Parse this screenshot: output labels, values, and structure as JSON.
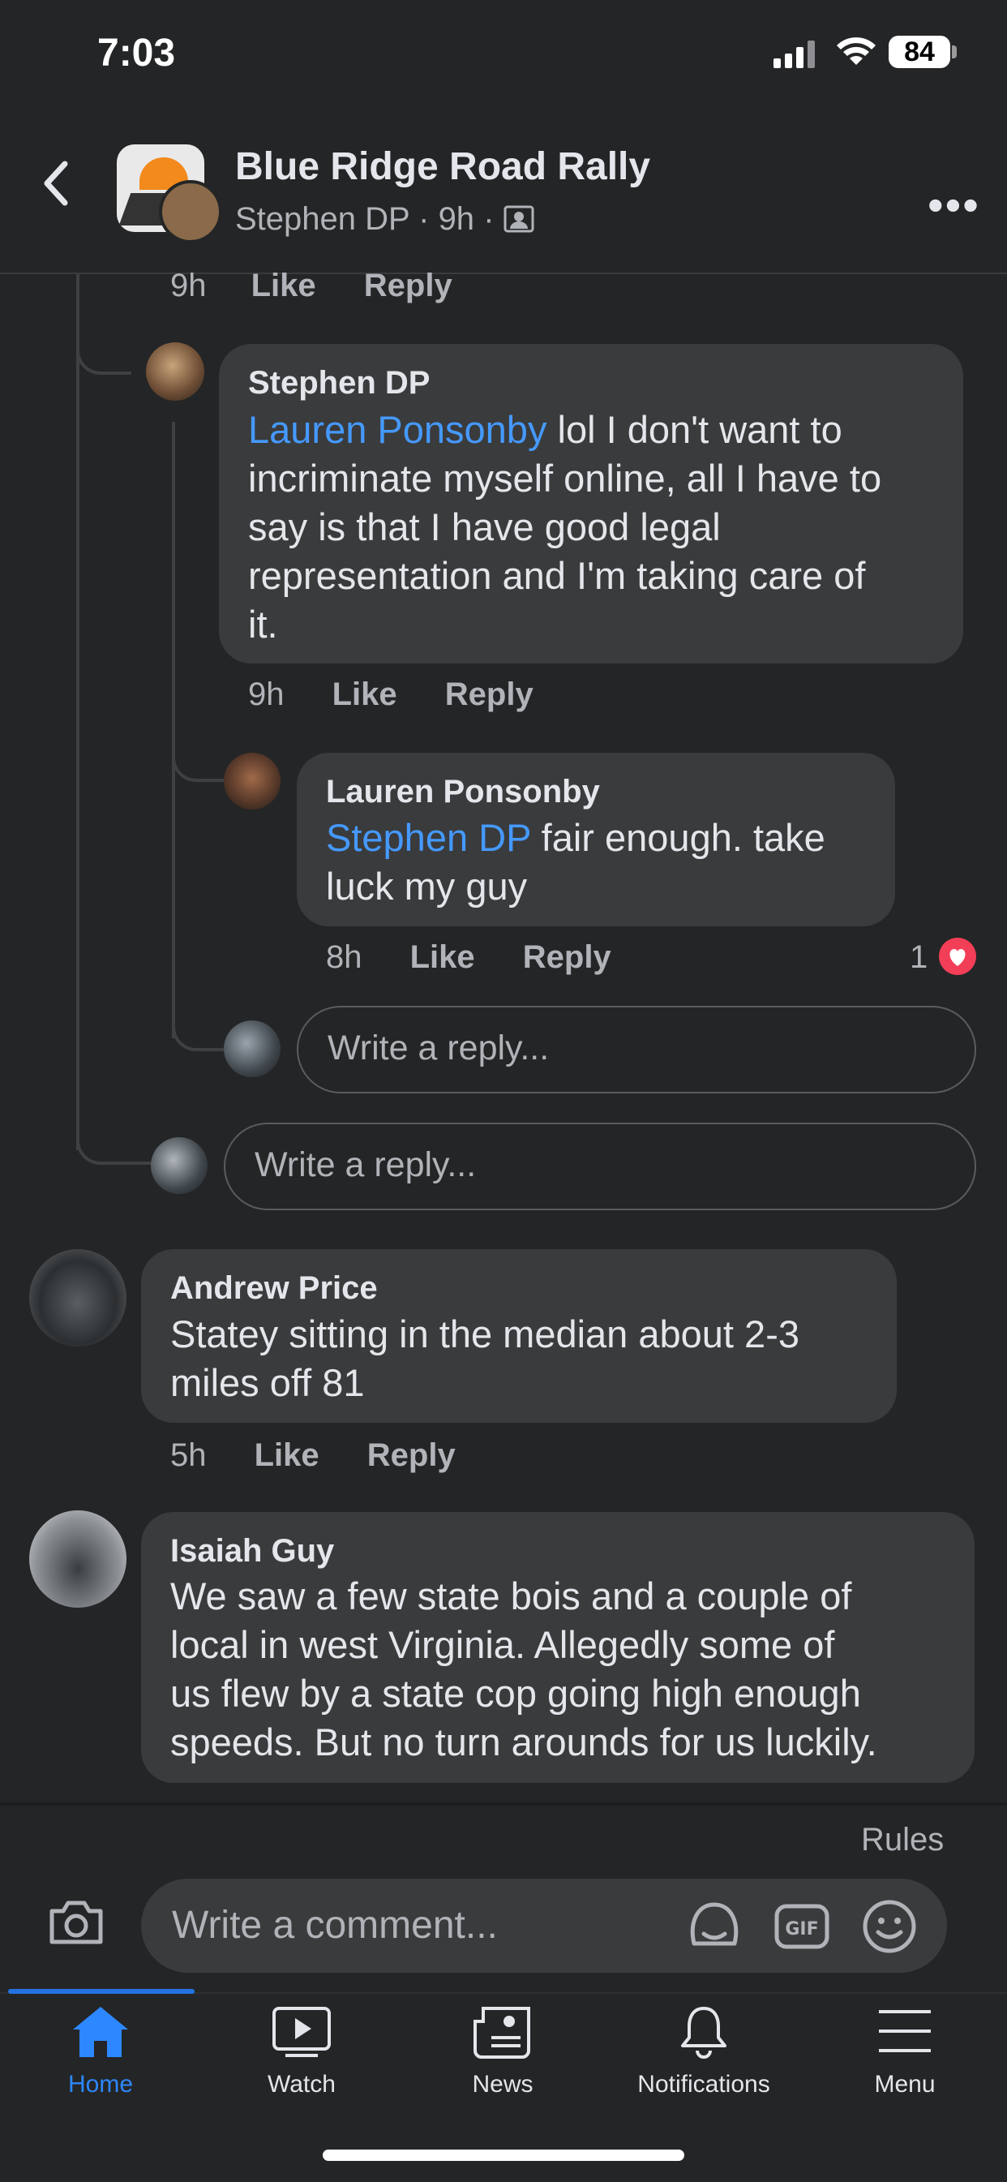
{
  "status": {
    "time": "7:03",
    "battery": "84"
  },
  "header": {
    "title": "Blue Ridge Road Rally",
    "subtitle_author": "Stephen DP",
    "subtitle_time": "9h",
    "sep": "·"
  },
  "top_meta": {
    "time": "9h",
    "like": "Like",
    "reply": "Reply"
  },
  "comments": [
    {
      "name": "Stephen DP",
      "mention": "Lauren Ponsonby",
      "text_lines": [
        " lol I don't want to",
        "incriminate myself online, all I have to",
        "say is that I have good legal",
        "representation and I'm taking care of",
        "it."
      ],
      "time": "9h",
      "like": "Like",
      "reply": "Reply"
    },
    {
      "name": "Lauren Ponsonby",
      "mention": "Stephen DP",
      "text_lines": [
        " fair enough. take",
        "luck my guy"
      ],
      "time": "8h",
      "like": "Like",
      "reply": "Reply",
      "reactions": "1"
    },
    {
      "name": "Andrew Price",
      "text_lines": [
        "Statey sitting in the median about 2-3",
        "miles off 81"
      ],
      "time": "5h",
      "like": "Like",
      "reply": "Reply"
    },
    {
      "name": "Isaiah Guy",
      "text_lines": [
        "We saw a few state bois and a couple of",
        "local in west Virginia. Allegedly some of",
        "us flew by a state cop going high enough",
        "speeds. But no turn arounds for us luckily."
      ]
    }
  ],
  "reply_placeholder": "Write a reply...",
  "composer": {
    "rules": "Rules",
    "placeholder": "Write a comment..."
  },
  "tabs": [
    {
      "label": "Home",
      "icon": "home-icon",
      "active": true
    },
    {
      "label": "Watch",
      "icon": "watch-icon"
    },
    {
      "label": "News",
      "icon": "news-icon"
    },
    {
      "label": "Notifications",
      "icon": "bell-icon"
    },
    {
      "label": "Menu",
      "icon": "menu-icon"
    }
  ],
  "colors": {
    "background": "#242526",
    "bubble": "#3a3b3c",
    "mention": "#4599ff",
    "accent": "#2d88ff",
    "heart": "#f33e58"
  }
}
